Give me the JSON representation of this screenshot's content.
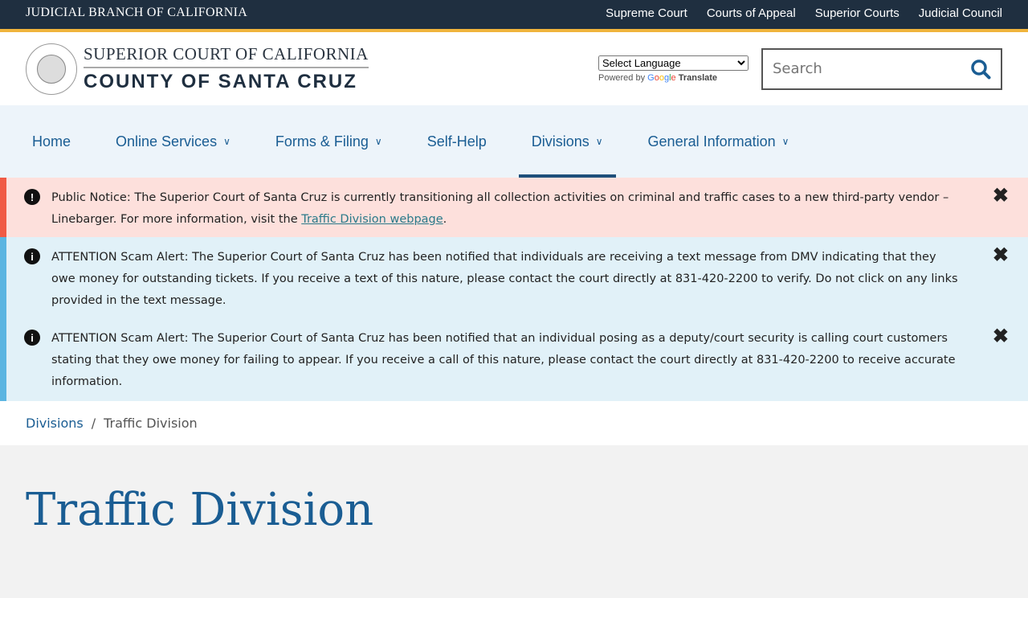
{
  "topbar": {
    "brand": "JUDICIAL BRANCH OF CALIFORNIA",
    "links": [
      "Supreme Court",
      "Courts of Appeal",
      "Superior Courts",
      "Judicial Council"
    ]
  },
  "header": {
    "logo_line1": "SUPERIOR COURT OF CALIFORNIA",
    "logo_line2": "COUNTY OF SANTA CRUZ",
    "seal_text": "JUDICIAL BRANCH OF CALIFORNIA",
    "language_select": "Select Language",
    "powered_by": "Powered by",
    "google": "Google",
    "translate": "Translate",
    "search_placeholder": "Search"
  },
  "nav": [
    {
      "label": "Home",
      "dropdown": false
    },
    {
      "label": "Online Services",
      "dropdown": true
    },
    {
      "label": "Forms & Filing",
      "dropdown": true
    },
    {
      "label": "Self-Help",
      "dropdown": false
    },
    {
      "label": "Divisions",
      "dropdown": true,
      "active": true
    },
    {
      "label": "General Information",
      "dropdown": true
    }
  ],
  "alerts": [
    {
      "type": "notice",
      "text": "Public Notice: The Superior Court of Santa Cruz is currently transitioning all collection activities on criminal and traffic cases to a new third-party vendor – Linebarger. For more information, visit the ",
      "link": "Traffic Division webpage",
      "after": "."
    },
    {
      "type": "info",
      "text": "ATTENTION Scam Alert: The Superior Court of Santa Cruz has been notified that individuals are receiving a text message from DMV indicating that they owe money for outstanding tickets. If you receive a text of this nature, please contact the court directly at 831-420-2200 to verify. Do not click on any links provided in the text message."
    },
    {
      "type": "info",
      "text": "ATTENTION Scam Alert: The Superior Court of Santa Cruz has been notified that an individual posing as a deputy/court security is calling court customers stating that they owe money for failing to appear. If you receive a call of this nature, please contact the court directly at 831-420-2200 to receive accurate information."
    }
  ],
  "icons": {
    "notice": "!",
    "info": "i",
    "close": "✕",
    "chevron": "⌄"
  },
  "breadcrumb": {
    "parent": "Divisions",
    "sep": "/",
    "current": "Traffic Division"
  },
  "page_title": "Traffic Division",
  "colors": {
    "topbar": "#1f2f40",
    "accent": "#f0b43c",
    "link": "#1a5d93",
    "notice_bg": "#fde0dc",
    "info_bg": "#e1f1f8"
  }
}
